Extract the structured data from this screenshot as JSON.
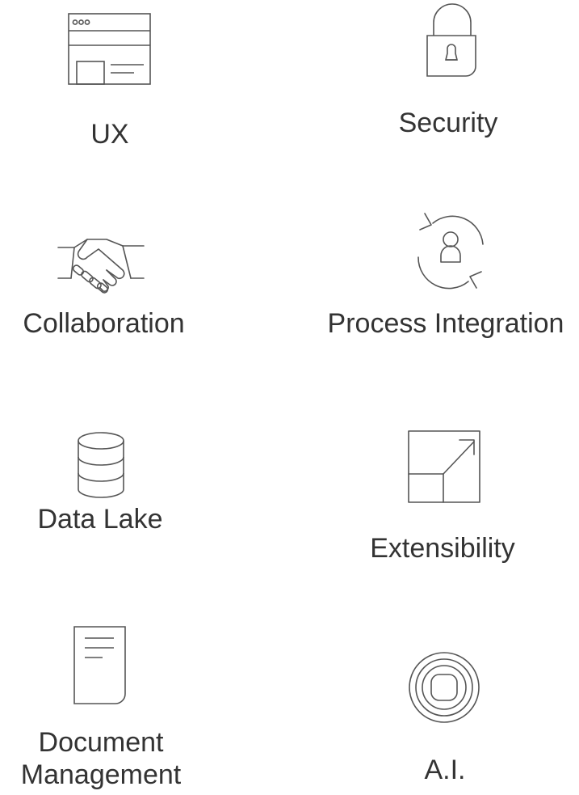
{
  "tiles": [
    {
      "label": "UX",
      "icon": "browser-window-icon"
    },
    {
      "label": "Security",
      "icon": "lock-icon"
    },
    {
      "label": "Collaboration",
      "icon": "handshake-icon"
    },
    {
      "label": "Process Integration",
      "icon": "user-sync-icon"
    },
    {
      "label": "Data Lake",
      "icon": "database-icon"
    },
    {
      "label": "Extensibility",
      "icon": "expand-arrow-icon"
    },
    {
      "label": "Document\nManagement",
      "icon": "document-icon"
    },
    {
      "label": "A.I.",
      "icon": "ai-chip-icon"
    }
  ],
  "colors": {
    "icon_stroke": "#555555",
    "text": "#333333",
    "background": "#ffffff"
  }
}
